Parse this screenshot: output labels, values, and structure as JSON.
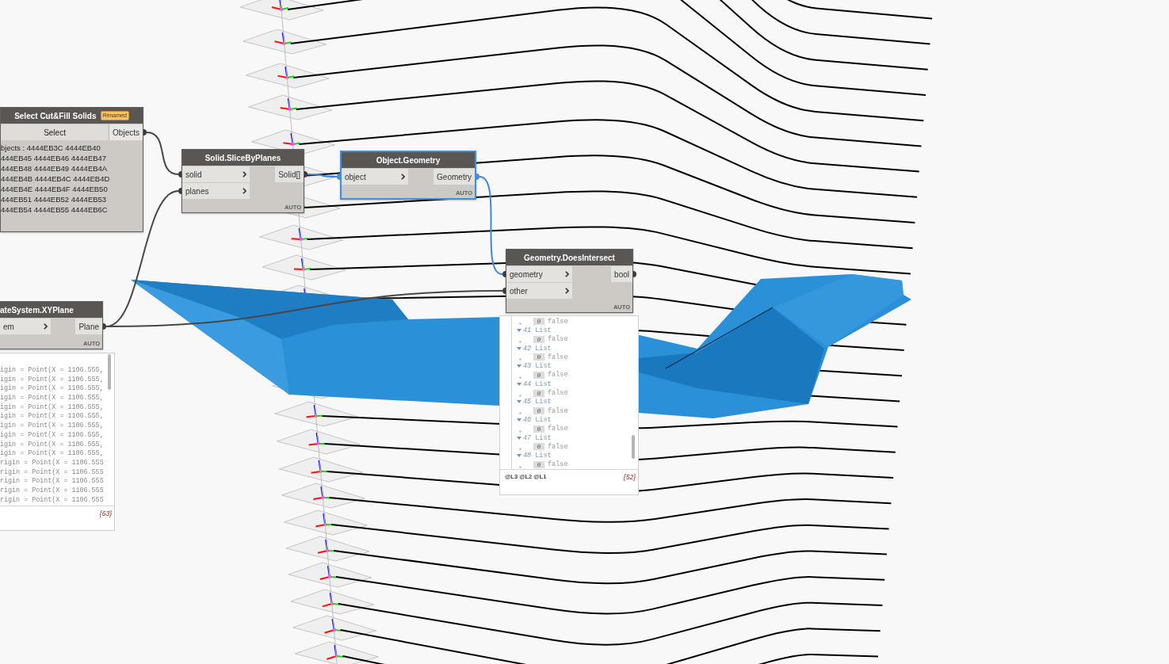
{
  "nodes": [
    {
      "kind": "select",
      "title": "Select Cut&Fill Solids",
      "badge": "Renamed",
      "selected": false,
      "button": "Select",
      "outputs": [
        "Objects"
      ],
      "preview_lines": [
        "bjects : 4444EB3C 4444EB40",
        "444EB45 4444EB46 4444EB47",
        "444EB48 4444EB49 4444EB4A",
        "444EB4B 4444EB4C 4444EB4D",
        "444EB4E 4444EB4F 4444EB50",
        "444EB51 4444EB52 4444EB53",
        "444EB54 4444EB55 4444EB6C"
      ]
    },
    {
      "kind": "function",
      "title": "Solid.SliceByPlanes",
      "selected": false,
      "inputs": [
        "solid",
        "planes"
      ],
      "outputs": [
        "Solid[]"
      ],
      "lacing": "AUTO"
    },
    {
      "kind": "function",
      "title": "Object.Geometry",
      "selected": true,
      "inputs": [
        "object"
      ],
      "outputs": [
        "Geometry"
      ],
      "lacing": "AUTO"
    },
    {
      "kind": "function",
      "title": "Geometry.DoesIntersect",
      "selected": false,
      "inputs": [
        "geometry",
        "other"
      ],
      "outputs": [
        "bool"
      ],
      "lacing": "AUTO",
      "watch": {
        "rows": [
          {
            "kind": "leaf",
            "index": "0",
            "value": "false"
          },
          {
            "kind": "list",
            "index": "41",
            "label": "List",
            "expanded": true,
            "children": [
              {
                "kind": "leaf",
                "index": "0",
                "value": "false"
              }
            ]
          },
          {
            "kind": "list",
            "index": "42",
            "label": "List",
            "expanded": true,
            "children": [
              {
                "kind": "leaf",
                "index": "0",
                "value": "false"
              }
            ]
          },
          {
            "kind": "list",
            "index": "43",
            "label": "List",
            "expanded": true,
            "children": [
              {
                "kind": "leaf",
                "index": "0",
                "value": "false"
              }
            ]
          },
          {
            "kind": "list",
            "index": "44",
            "label": "List",
            "expanded": true,
            "children": [
              {
                "kind": "leaf",
                "index": "0",
                "value": "false"
              }
            ]
          },
          {
            "kind": "list",
            "index": "45",
            "label": "List",
            "expanded": true,
            "children": [
              {
                "kind": "leaf",
                "index": "0",
                "value": "false"
              }
            ]
          },
          {
            "kind": "list",
            "index": "46",
            "label": "List",
            "expanded": true,
            "children": [
              {
                "kind": "leaf",
                "index": "0",
                "value": "false"
              }
            ]
          },
          {
            "kind": "list",
            "index": "47",
            "label": "List",
            "expanded": true,
            "children": [
              {
                "kind": "leaf",
                "index": "0",
                "value": "false"
              }
            ]
          },
          {
            "kind": "list",
            "index": "48",
            "label": "List",
            "expanded": true,
            "children": [
              {
                "kind": "leaf",
                "index": "0",
                "value": "false"
              }
            ]
          }
        ],
        "levels": "@L3 @L2 @L1",
        "count": "{52}"
      }
    },
    {
      "kind": "function",
      "title": "ateSystem.XYPlane",
      "selected": false,
      "inputs": [
        "em"
      ],
      "outputs": [
        "Plane"
      ],
      "lacing": "AUTO",
      "watch": {
        "rows": [
          {
            "kind": "text",
            "text": "igin = Point(X = 1106.555,"
          },
          {
            "kind": "text",
            "text": "igin = Point(X = 1106.555,"
          },
          {
            "kind": "text",
            "text": "igin = Point(X = 1106.555,"
          },
          {
            "kind": "text",
            "text": "igin = Point(X = 1106.555,"
          },
          {
            "kind": "text",
            "text": "igin = Point(X = 1106.555,"
          },
          {
            "kind": "text",
            "text": "igin = Point(X = 1106.555,"
          },
          {
            "kind": "text",
            "text": "igin = Point(X = 1106.555,"
          },
          {
            "kind": "text",
            "text": "igin = Point(X = 1106.555,"
          },
          {
            "kind": "text",
            "text": "igin = Point(X = 1106.555,"
          },
          {
            "kind": "text",
            "text": "igin = Point(X = 1106.555,"
          },
          {
            "kind": "text",
            "text": "rigin = Point(X = 1106.555"
          },
          {
            "kind": "text",
            "text": "rigin = Point(X = 1106.555"
          },
          {
            "kind": "text",
            "text": "rigin = Point(X = 1106.555"
          },
          {
            "kind": "text",
            "text": "rigin = Point(X = 1106.555"
          },
          {
            "kind": "text",
            "text": "rigin = Point(X = 1106.555"
          }
        ],
        "count": "{63}"
      }
    }
  ]
}
